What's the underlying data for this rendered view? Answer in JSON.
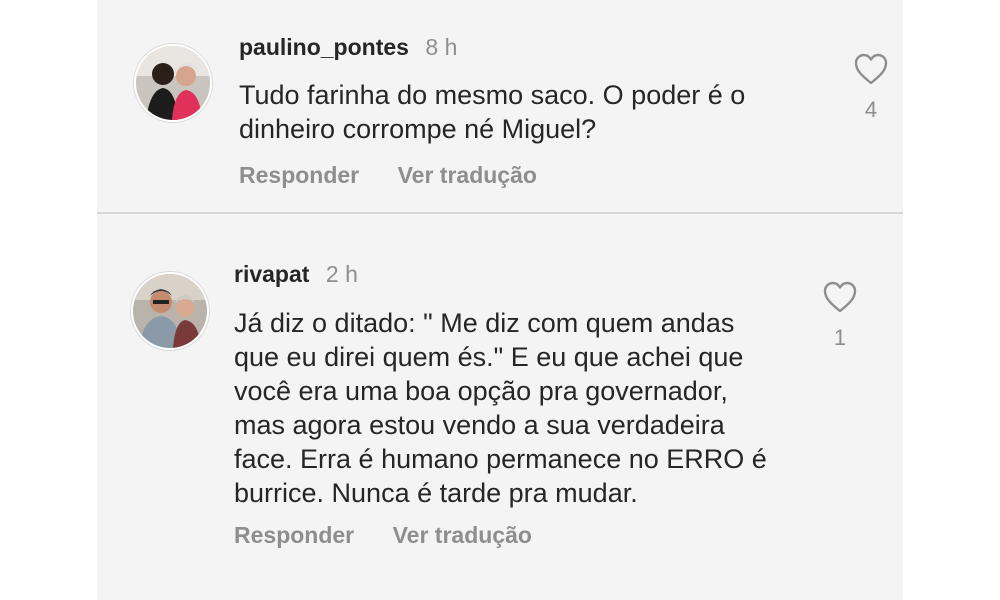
{
  "comments": [
    {
      "username": "paulino_pontes",
      "time": "8 h",
      "lines": [
        "Tudo farinha do mesmo saco. O poder é o",
        "dinheiro corrompe né Miguel?"
      ],
      "like_count": "4",
      "reply_label": "Responder",
      "translate_label": "Ver tradução",
      "like_icon": "heart-outline-icon"
    },
    {
      "username": "rivapat",
      "time": "2 h",
      "lines": [
        "Já diz o ditado: \" Me diz com quem andas",
        "que eu direi quem és.\" E eu que achei que",
        "você era uma boa opção pra governador,",
        "mas agora estou vendo a sua verdadeira",
        "face. Erra é humano permanece no ERRO é",
        "burrice. Nunca é tarde pra mudar."
      ],
      "like_count": "1",
      "reply_label": "Responder",
      "translate_label": "Ver tradução",
      "like_icon": "heart-outline-icon"
    }
  ],
  "colors": {
    "panel_bg": "#f4f4f4",
    "text_primary": "#262626",
    "text_secondary": "#8e8e8e",
    "divider": "#d6d6d6"
  }
}
